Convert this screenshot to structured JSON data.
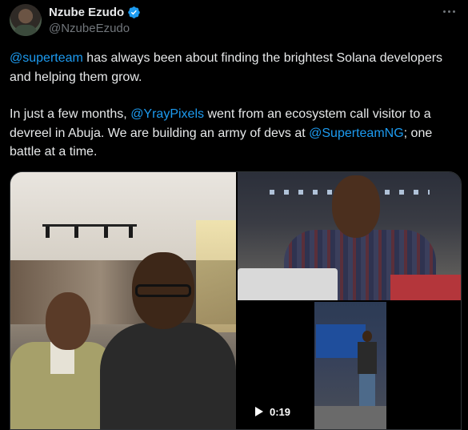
{
  "author": {
    "display_name": "Nzube Ezudo",
    "handle": "@NzubeEzudo",
    "verified": true
  },
  "tweet": {
    "paragraph1": [
      {
        "text": "@superteam",
        "type": "mention"
      },
      {
        "text": " has always been about finding the brightest Solana developers and helping them grow.",
        "type": "text"
      }
    ],
    "paragraph2": [
      {
        "text": "In just a few months, ",
        "type": "text"
      },
      {
        "text": "@YrayPixels",
        "type": "mention"
      },
      {
        "text": " went from an ecosystem call visitor to a devreel in Abuja. We are building an army of devs at ",
        "type": "text"
      },
      {
        "text": "@SuperteamNG",
        "type": "mention"
      },
      {
        "text": "; one battle at a time.",
        "type": "text"
      }
    ]
  },
  "media": {
    "video_duration": "0:19"
  },
  "colors": {
    "mention": "#1d9bf0",
    "text": "#e7e9ea",
    "muted": "#71767b",
    "background": "#000000"
  },
  "icons": {
    "verified": "verified-badge-icon",
    "more": "more-options-icon",
    "play": "play-icon"
  }
}
